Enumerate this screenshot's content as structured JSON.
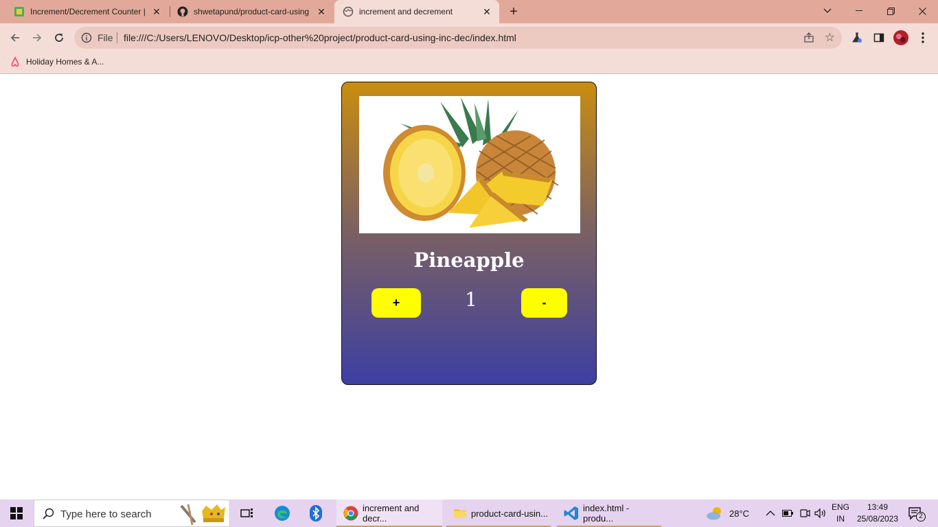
{
  "browser": {
    "tabs": [
      {
        "title": "Increment/Decrement Counter |",
        "favicon": "codepen-icon",
        "active": false
      },
      {
        "title": "shwetapund/product-card-using",
        "favicon": "github-icon",
        "active": false
      },
      {
        "title": "increment and decrement",
        "favicon": "globe-icon",
        "active": true
      }
    ],
    "address": {
      "scheme_label": "File",
      "url": "file:///C:/Users/LENOVO/Desktop/icp-other%20project/product-card-using-inc-dec/index.html"
    },
    "bookmarks": [
      {
        "label": "Holiday Homes & A...",
        "icon": "airbnb-icon"
      }
    ]
  },
  "page": {
    "product": {
      "name": "Pineapple",
      "image": "pineapple-image",
      "quantity": "1",
      "increment_label": "+",
      "decrement_label": "-"
    },
    "colors": {
      "card_gradient_top": "#c98d10",
      "card_gradient_bottom": "#3d3fa3",
      "button": "#ffff00"
    }
  },
  "taskbar": {
    "search_placeholder": "Type here to search",
    "apps": [
      {
        "label": "increment and decr...",
        "icon": "chrome-icon"
      },
      {
        "label": "product-card-usin...",
        "icon": "folder-icon"
      },
      {
        "label": "index.html - produ...",
        "icon": "vscode-icon"
      }
    ],
    "weather": "28°C",
    "language": {
      "line1": "ENG",
      "line2": "IN"
    },
    "time": "13:49",
    "date": "25/08/2023",
    "notifications": "2"
  }
}
